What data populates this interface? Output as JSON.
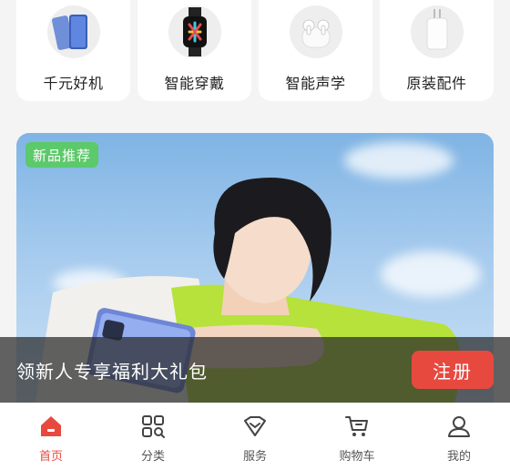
{
  "categories": [
    {
      "label": "千元好机",
      "icon": "phone-icon"
    },
    {
      "label": "智能穿戴",
      "icon": "smartwatch-icon"
    },
    {
      "label": "智能声学",
      "icon": "earbuds-icon"
    },
    {
      "label": "原装配件",
      "icon": "charger-icon"
    }
  ],
  "banner": {
    "tag": "新品推荐"
  },
  "promo": {
    "text": "领新人专享福利大礼包",
    "button_label": "注册"
  },
  "tabbar": {
    "items": [
      {
        "label": "首页",
        "icon": "home-icon",
        "active": true
      },
      {
        "label": "分类",
        "icon": "category-icon",
        "active": false
      },
      {
        "label": "服务",
        "icon": "service-icon",
        "active": false
      },
      {
        "label": "购物车",
        "icon": "cart-icon",
        "active": false
      },
      {
        "label": "我的",
        "icon": "profile-icon",
        "active": false
      }
    ]
  },
  "colors": {
    "accent": "#e8493f",
    "tag": "#5cc96a"
  }
}
